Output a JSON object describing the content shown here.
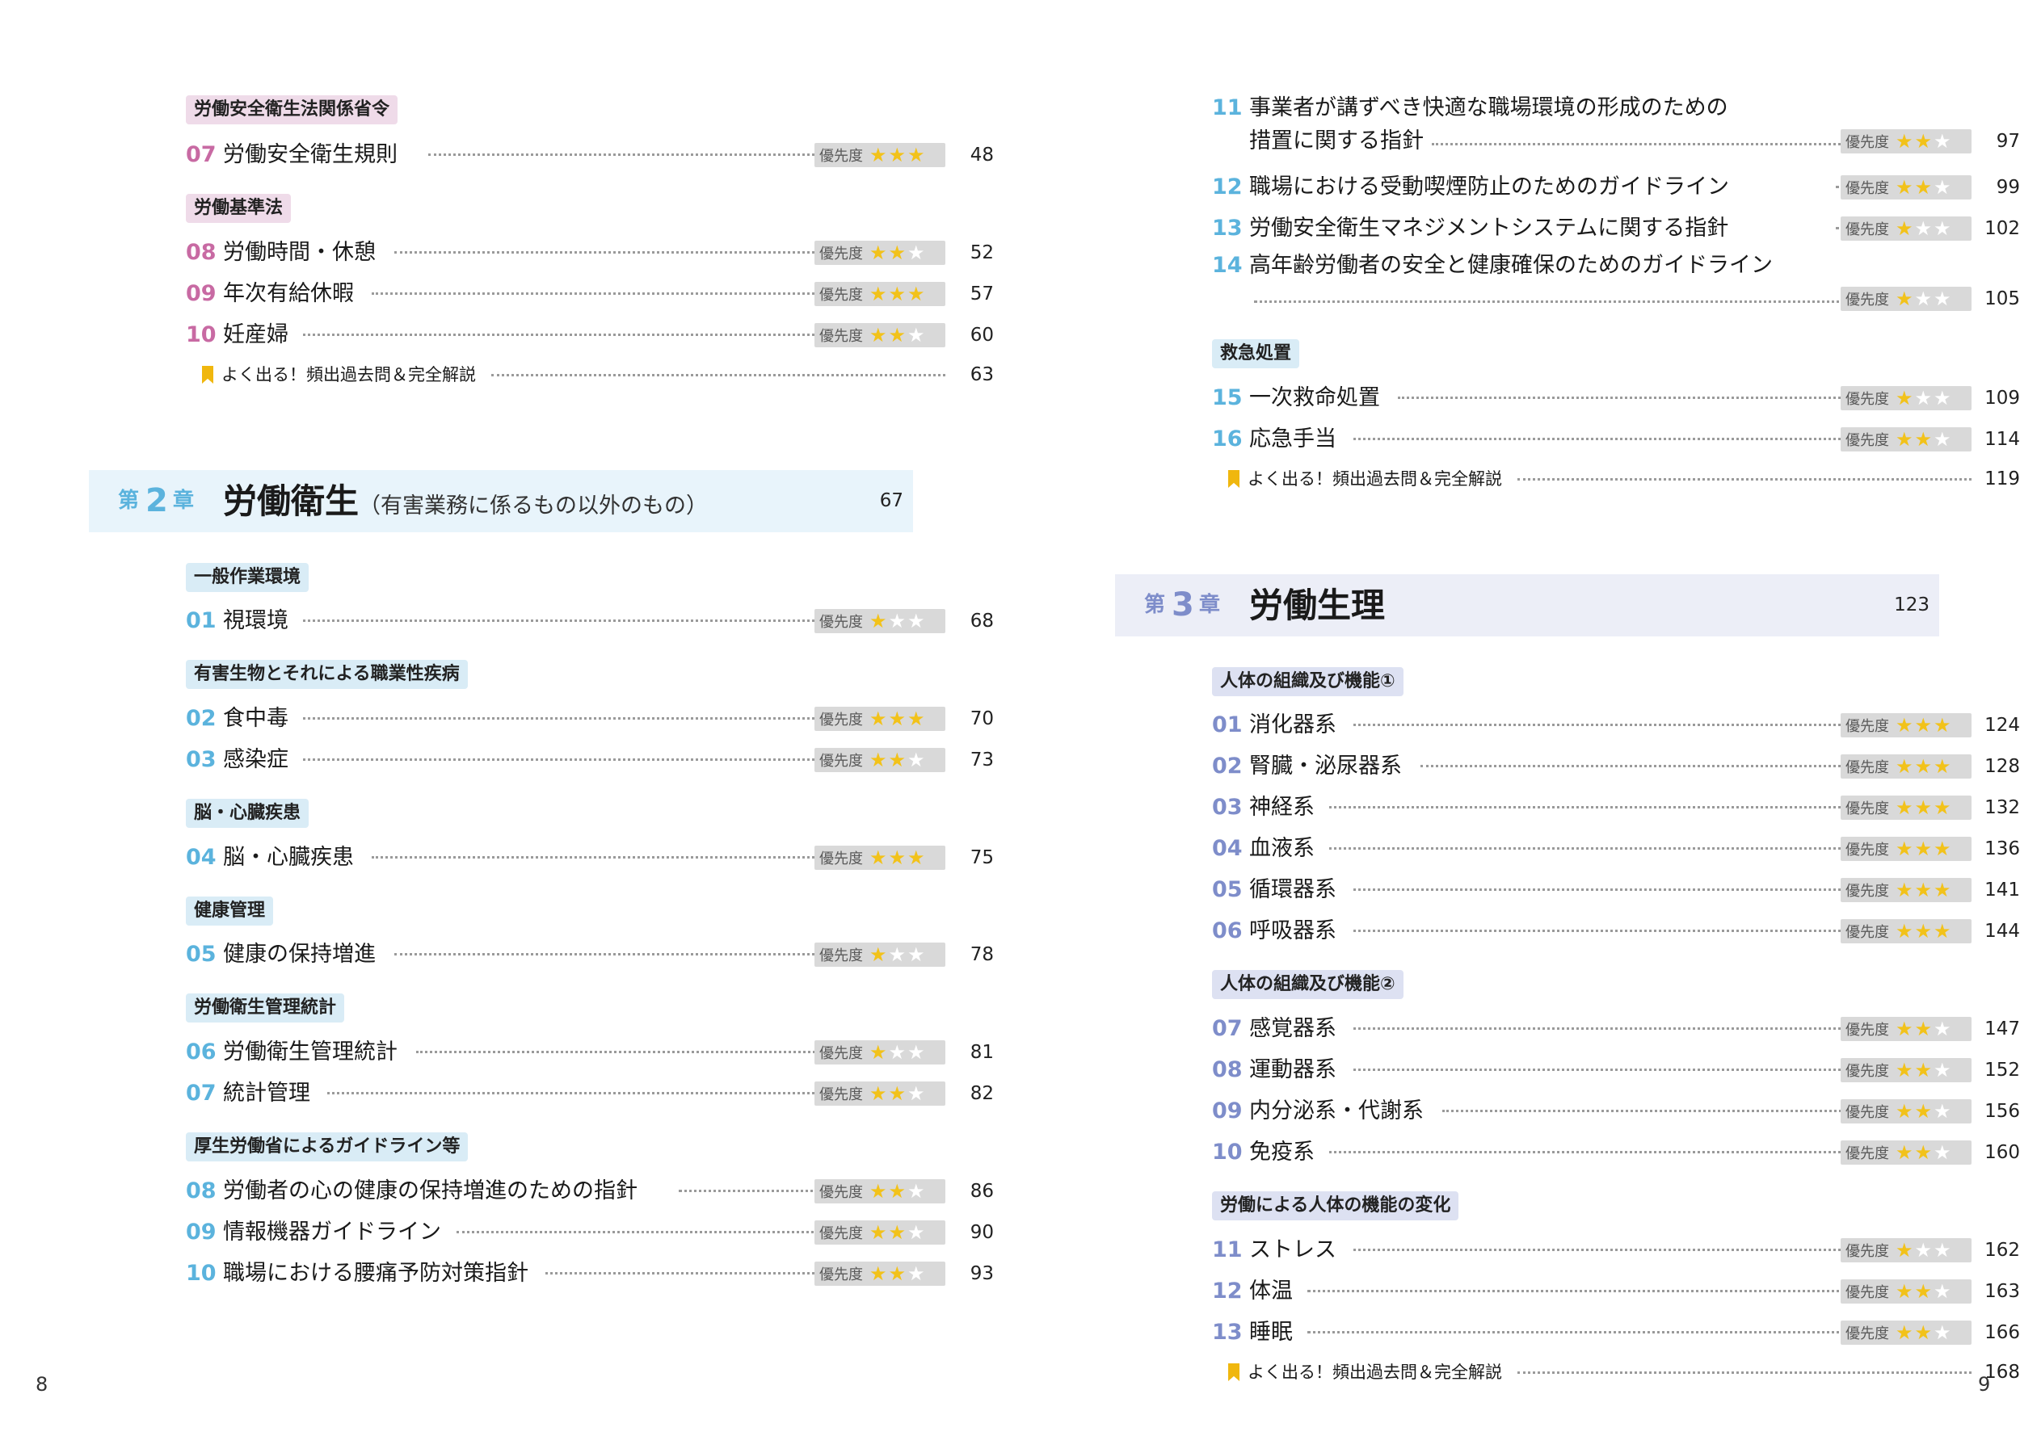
{
  "left": {
    "sections": [
      {
        "label": "労働安全衛生法関係省令",
        "color": "pink",
        "entries": [
          {
            "num": "07",
            "title": "労働安全衛生規則",
            "stars": 3,
            "page": "48"
          }
        ]
      },
      {
        "label": "労働基準法",
        "color": "pink",
        "entries": [
          {
            "num": "08",
            "title": "労働時間・休憩",
            "stars": 2,
            "page": "52"
          },
          {
            "num": "09",
            "title": "年次有給休暇",
            "stars": 3,
            "page": "57"
          },
          {
            "num": "10",
            "title": "妊産婦",
            "stars": 2,
            "page": "60"
          }
        ],
        "review": {
          "title": "よく出る！頻出過去問＆完全解説",
          "page": "63"
        }
      }
    ],
    "chapter2": {
      "first": "第",
      "num": "2",
      "last": "章",
      "title": "労働衛生",
      "subtitle": "（有害業務に係るもの以外のもの）",
      "page": "67"
    },
    "ch2_sections": [
      {
        "label": "一般作業環境",
        "entries": [
          {
            "num": "01",
            "title": "視環境",
            "stars": 1,
            "page": "68"
          }
        ]
      },
      {
        "label": "有害生物とそれによる職業性疾病",
        "entries": [
          {
            "num": "02",
            "title": "食中毒",
            "stars": 3,
            "page": "70"
          },
          {
            "num": "03",
            "title": "感染症",
            "stars": 2,
            "page": "73"
          }
        ]
      },
      {
        "label": "脳・心臓疾患",
        "entries": [
          {
            "num": "04",
            "title": "脳・心臓疾患",
            "stars": 3,
            "page": "75"
          }
        ]
      },
      {
        "label": "健康管理",
        "entries": [
          {
            "num": "05",
            "title": "健康の保持増進",
            "stars": 1,
            "page": "78"
          }
        ]
      },
      {
        "label": "労働衛生管理統計",
        "entries": [
          {
            "num": "06",
            "title": "労働衛生管理統計",
            "stars": 1,
            "page": "81"
          },
          {
            "num": "07",
            "title": "統計管理",
            "stars": 2,
            "page": "82"
          }
        ]
      },
      {
        "label": "厚生労働省によるガイドライン等",
        "entries": [
          {
            "num": "08",
            "title": "労働者の心の健康の保持増進のための指針",
            "stars": 2,
            "page": "86"
          },
          {
            "num": "09",
            "title": "情報機器ガイドライン",
            "stars": 2,
            "page": "90"
          },
          {
            "num": "10",
            "title": "職場における腰痛予防対策指針",
            "stars": 2,
            "page": "93"
          }
        ]
      }
    ],
    "folio": "8"
  },
  "right": {
    "guideline_entries": [
      {
        "num": "11",
        "title_line1": "事業者が講ずべき快適な職場環境の形成のための",
        "title_line2": "措置に関する指針",
        "stars": 2,
        "page": "97"
      },
      {
        "num": "12",
        "title": "職場における受動喫煙防止のためのガイドライン",
        "stars": 2,
        "page": "99"
      },
      {
        "num": "13",
        "title": "労働安全衛生マネジメントシステムに関する指針",
        "stars": 1,
        "page": "102"
      },
      {
        "num": "14",
        "title": "高年齢労働者の安全と健康確保のためのガイドライン",
        "stars": 1,
        "page": "105"
      }
    ],
    "first_aid": {
      "label": "救急処置",
      "entries": [
        {
          "num": "15",
          "title": "一次救命処置",
          "stars": 1,
          "page": "109"
        },
        {
          "num": "16",
          "title": "応急手当",
          "stars": 2,
          "page": "114"
        }
      ],
      "review": {
        "title": "よく出る！頻出過去問＆完全解説",
        "page": "119"
      }
    },
    "chapter3": {
      "first": "第",
      "num": "3",
      "last": "章",
      "title": "労働生理",
      "page": "123"
    },
    "ch3_sections": [
      {
        "label": "人体の組織及び機能①",
        "entries": [
          {
            "num": "01",
            "title": "消化器系",
            "stars": 3,
            "page": "124"
          },
          {
            "num": "02",
            "title": "腎臓・泌尿器系",
            "stars": 3,
            "page": "128"
          },
          {
            "num": "03",
            "title": "神経系",
            "stars": 3,
            "page": "132"
          },
          {
            "num": "04",
            "title": "血液系",
            "stars": 3,
            "page": "136"
          },
          {
            "num": "05",
            "title": "循環器系",
            "stars": 3,
            "page": "141"
          },
          {
            "num": "06",
            "title": "呼吸器系",
            "stars": 3,
            "page": "144"
          }
        ]
      },
      {
        "label": "人体の組織及び機能②",
        "entries": [
          {
            "num": "07",
            "title": "感覚器系",
            "stars": 2,
            "page": "147"
          },
          {
            "num": "08",
            "title": "運動器系",
            "stars": 2,
            "page": "152"
          },
          {
            "num": "09",
            "title": "内分泌系・代謝系",
            "stars": 2,
            "page": "156"
          },
          {
            "num": "10",
            "title": "免疫系",
            "stars": 2,
            "page": "160"
          }
        ]
      },
      {
        "label": "労働による人体の機能の変化",
        "entries": [
          {
            "num": "11",
            "title": "ストレス",
            "stars": 1,
            "page": "162"
          },
          {
            "num": "12",
            "title": "体温",
            "stars": 2,
            "page": "163"
          },
          {
            "num": "13",
            "title": "睡眠",
            "stars": 2,
            "page": "166"
          }
        ],
        "review": {
          "title": "よく出る！頻出過去問＆完全解説",
          "page": "168"
        }
      }
    ],
    "folio": "9"
  },
  "priority_label": "優先度",
  "colors": {
    "ch1_number": "#c86aa3",
    "ch2_number": "#5bb3dd",
    "ch3_number": "#7e8dca",
    "ch2_band": "#e8f4fb",
    "ch3_band": "#eceef7",
    "star_on": "#f2c21a"
  }
}
